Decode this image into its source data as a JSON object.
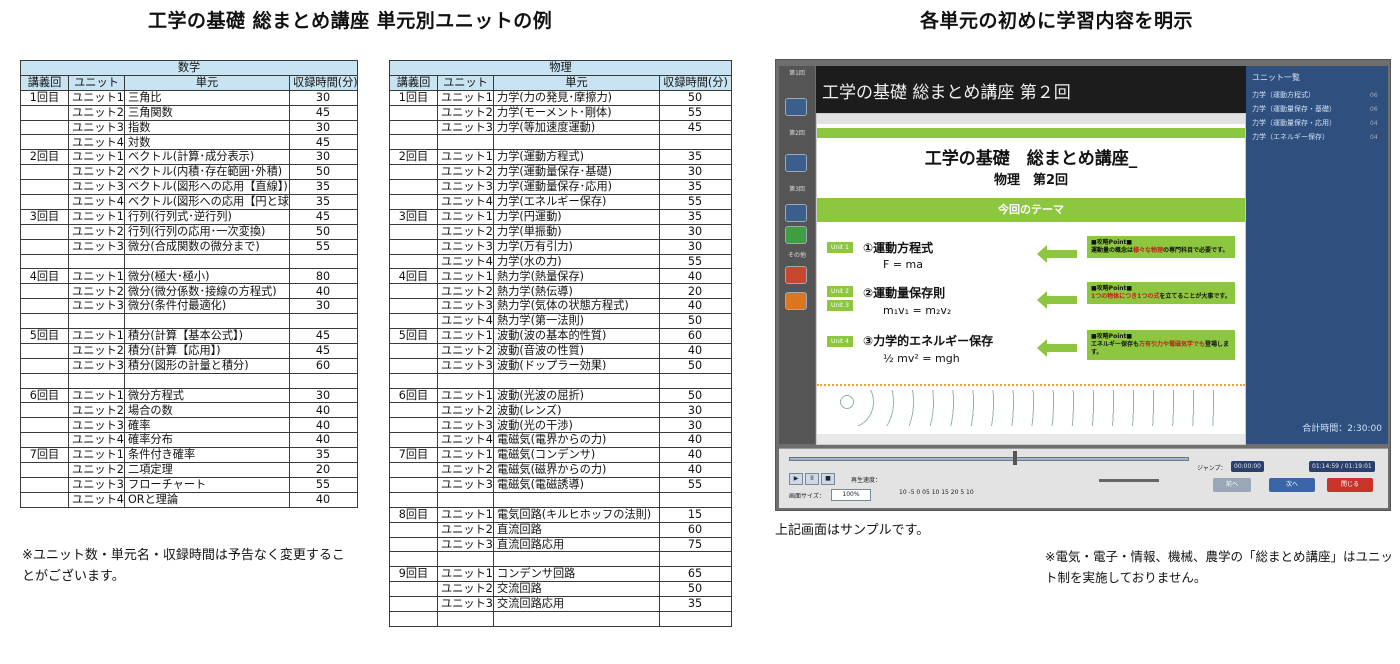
{
  "headings": {
    "left": "工学の基礎 総まとめ講座 単元別ユニットの例",
    "right": "各単元の初めに学習内容を明示"
  },
  "columns": {
    "lecture": "講義回",
    "unit": "ユニット",
    "topic": "単元",
    "minutes": "収録時間(分)"
  },
  "math": {
    "subject": "数学",
    "rows": [
      [
        "1回目",
        "ユニット1",
        "三角比",
        "30"
      ],
      [
        "",
        "ユニット2",
        "三角関数",
        "45"
      ],
      [
        "",
        "ユニット3",
        "指数",
        "30"
      ],
      [
        "",
        "ユニット4",
        "対数",
        "45"
      ],
      [
        "2回目",
        "ユニット1",
        "ベクトル(計算･成分表示)",
        "30"
      ],
      [
        "",
        "ユニット2",
        "ベクトル(内積･存在範囲･外積)",
        "50"
      ],
      [
        "",
        "ユニット3",
        "ベクトル(図形への応用【直線】)",
        "35"
      ],
      [
        "",
        "ユニット4",
        "ベクトル(図形への応用【円と球】)",
        "35"
      ],
      [
        "3回目",
        "ユニット1",
        "行列(行列式･逆行列)",
        "45"
      ],
      [
        "",
        "ユニット2",
        "行列(行列の応用･一次変換)",
        "50"
      ],
      [
        "",
        "ユニット3",
        "微分(合成関数の微分まで)",
        "55"
      ],
      [
        "",
        "",
        "",
        ""
      ],
      [
        "4回目",
        "ユニット1",
        "微分(極大･極小)",
        "80"
      ],
      [
        "",
        "ユニット2",
        "微分(微分係数･接線の方程式)",
        "40"
      ],
      [
        "",
        "ユニット3",
        "微分(条件付最適化)",
        "30"
      ],
      [
        "",
        "",
        "",
        ""
      ],
      [
        "5回目",
        "ユニット1",
        "積分(計算【基本公式】)",
        "45"
      ],
      [
        "",
        "ユニット2",
        "積分(計算【応用】)",
        "45"
      ],
      [
        "",
        "ユニット3",
        "積分(図形の計量と積分)",
        "60"
      ],
      [
        "",
        "",
        "",
        ""
      ],
      [
        "6回目",
        "ユニット1",
        "微分方程式",
        "30"
      ],
      [
        "",
        "ユニット2",
        "場合の数",
        "40"
      ],
      [
        "",
        "ユニット3",
        "確率",
        "40"
      ],
      [
        "",
        "ユニット4",
        "確率分布",
        "40"
      ],
      [
        "7回目",
        "ユニット1",
        "条件付き確率",
        "35"
      ],
      [
        "",
        "ユニット2",
        "二項定理",
        "20"
      ],
      [
        "",
        "ユニット3",
        "フローチャート",
        "55"
      ],
      [
        "",
        "ユニット4",
        "ORと理論",
        "40"
      ]
    ]
  },
  "physics": {
    "subject": "物理",
    "rows": [
      [
        "1回目",
        "ユニット1",
        "力学(力の発見･摩擦力)",
        "50"
      ],
      [
        "",
        "ユニット2",
        "力学(モーメント･剛体)",
        "55"
      ],
      [
        "",
        "ユニット3",
        "力学(等加速度運動)",
        "45"
      ],
      [
        "",
        "",
        "",
        ""
      ],
      [
        "2回目",
        "ユニット1",
        "力学(運動方程式)",
        "35"
      ],
      [
        "",
        "ユニット2",
        "力学(運動量保存･基礎)",
        "30"
      ],
      [
        "",
        "ユニット3",
        "力学(運動量保存･応用)",
        "35"
      ],
      [
        "",
        "ユニット4",
        "力学(エネルギー保存)",
        "55"
      ],
      [
        "3回目",
        "ユニット1",
        "力学(円運動)",
        "35"
      ],
      [
        "",
        "ユニット2",
        "力学(単振動)",
        "30"
      ],
      [
        "",
        "ユニット3",
        "力学(万有引力)",
        "30"
      ],
      [
        "",
        "ユニット4",
        "力学(水の力)",
        "55"
      ],
      [
        "4回目",
        "ユニット1",
        "熱力学(熱量保存)",
        "40"
      ],
      [
        "",
        "ユニット2",
        "熱力学(熱伝導)",
        "20"
      ],
      [
        "",
        "ユニット3",
        "熱力学(気体の状態方程式)",
        "40"
      ],
      [
        "",
        "ユニット4",
        "熱力学(第一法則)",
        "50"
      ],
      [
        "5回目",
        "ユニット1",
        "波動(波の基本的性質)",
        "60"
      ],
      [
        "",
        "ユニット2",
        "波動(音波の性質)",
        "40"
      ],
      [
        "",
        "ユニット3",
        "波動(ドップラー効果)",
        "50"
      ],
      [
        "",
        "",
        "",
        ""
      ],
      [
        "6回目",
        "ユニット1",
        "波動(光波の屈折)",
        "50"
      ],
      [
        "",
        "ユニット2",
        "波動(レンズ)",
        "30"
      ],
      [
        "",
        "ユニット3",
        "波動(光の干渉)",
        "30"
      ],
      [
        "",
        "ユニット4",
        "電磁気(電界からの力)",
        "40"
      ],
      [
        "7回目",
        "ユニット1",
        "電磁気(コンデンサ)",
        "40"
      ],
      [
        "",
        "ユニット2",
        "電磁気(磁界からの力)",
        "40"
      ],
      [
        "",
        "ユニット3",
        "電磁気(電磁誘導)",
        "55"
      ],
      [
        "",
        "",
        "",
        ""
      ],
      [
        "8回目",
        "ユニット1",
        "電気回路(キルヒホッフの法則)",
        "15"
      ],
      [
        "",
        "ユニット2",
        "直流回路",
        "60"
      ],
      [
        "",
        "ユニット3",
        "直流回路応用",
        "75"
      ],
      [
        "",
        "",
        "",
        ""
      ],
      [
        "9回目",
        "ユニット1",
        "コンデンサ回路",
        "65"
      ],
      [
        "",
        "ユニット2",
        "交流回路",
        "50"
      ],
      [
        "",
        "ユニット3",
        "交流回路応用",
        "35"
      ],
      [
        "",
        "",
        "",
        ""
      ]
    ]
  },
  "note_left": "※ユニット数・単元名・収録時間は予告なく変更することがございます。",
  "player": {
    "left_items": [
      "第1回",
      "第2回",
      "第3回",
      "その他"
    ],
    "title": "工学の基礎 総まとめ講座 第２回",
    "slide": {
      "title1": "工学の基礎　総まとめ講座_",
      "title2": "物理　第2回",
      "theme": "今回のテーマ",
      "units": [
        "Unit 1",
        "Unit 2",
        "Unit 3",
        "Unit 4"
      ],
      "items": [
        "①運動方程式",
        "②運動量保存則",
        "③力学的エネルギー保存"
      ],
      "formulas": [
        "F = ma",
        "m₁v₁ = m₂v₂",
        "½ mv² = mgh"
      ],
      "points": [
        {
          "head": "■攻略Point■",
          "pre": "運動量の概念は",
          "red": "様々な物理",
          "post": "の専門科目で必要です。"
        },
        {
          "head": "■攻略Point■",
          "pre": "",
          "red": "1つの物体につき1つの式",
          "post": "を立てることが大事です。"
        },
        {
          "head": "■攻略Point■",
          "pre": "エネルギー保存も",
          "red": "万有引力や電磁気学でも",
          "post": "登場します。"
        }
      ]
    },
    "right_panel": {
      "header": "ユニット一覧",
      "items": [
        "力学（運動方程式）",
        "力学（運動量保存・基礎）",
        "力学（運動量保存・応用）",
        "力学（エネルギー保存）"
      ],
      "nums": [
        "06",
        "06",
        "04",
        "04"
      ],
      "total": "合計時間：2:30:00"
    },
    "controls": {
      "play": "▶",
      "pause": "II",
      "stop": "■",
      "speed_label": "再生速度：",
      "size_label": "画面サイズ：",
      "size_value": "100%",
      "speed_ticks": "10 -5  0  05     10        15        20  5  10",
      "jump_label": "ジャンプ：",
      "jump_value": "00:00:00",
      "time_value": "01:14:59 / 01:19:01",
      "prev": "前へ",
      "next": "次へ",
      "close": "閉じる"
    }
  },
  "caption_sample": "上記画面はサンプルです。",
  "note_right": "※電気・電子・情報、機械、農学の「総まとめ講座」はユニット制を実施しておりません。"
}
